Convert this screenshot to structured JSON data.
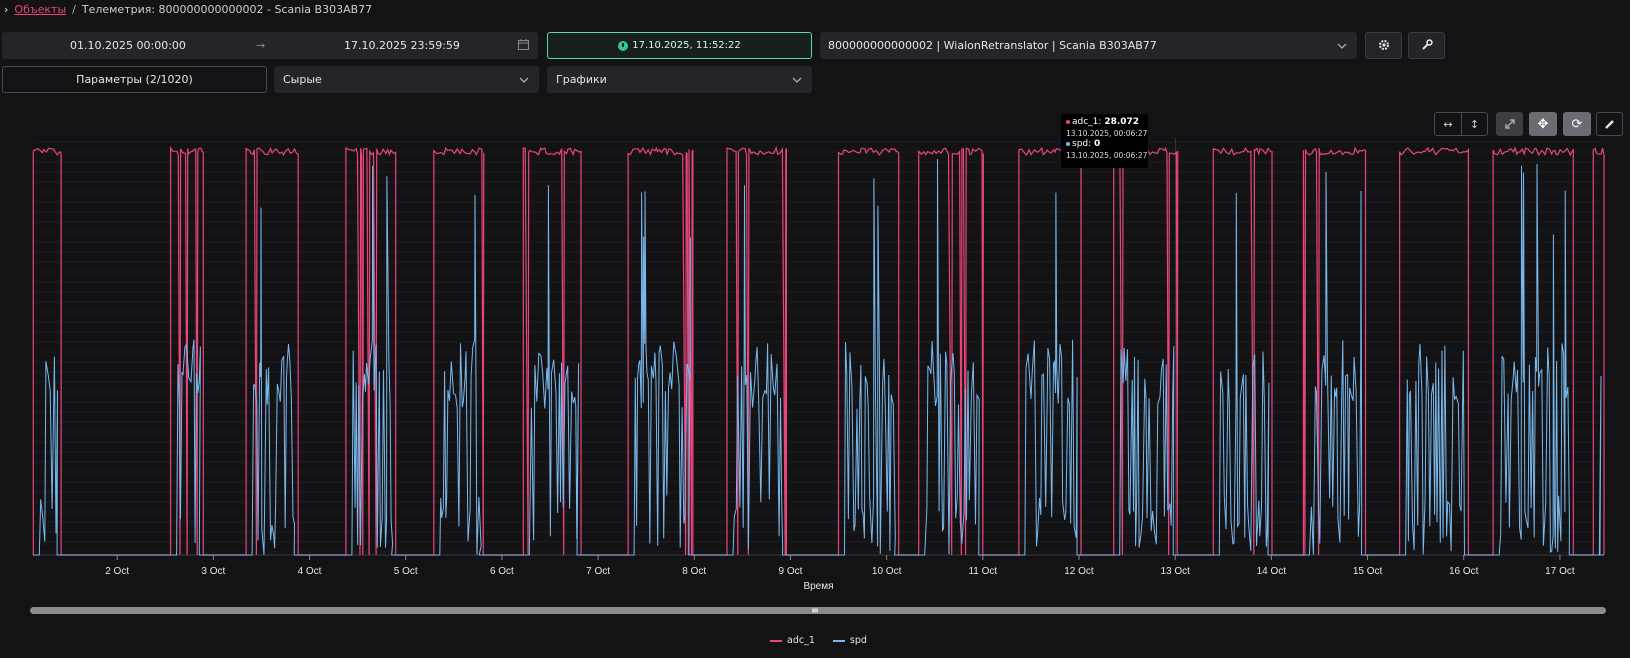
{
  "breadcrumb": {
    "root": "Объекты",
    "separator": "/",
    "current": "Телеметрия: 800000000000002 - Scania В303АВ77"
  },
  "filters": {
    "date_from": "01.10.2025 00:00:00",
    "date_to": "17.10.2025 23:59:59",
    "now": "17.10.2025, 11:52:22",
    "device": "800000000000002 | WialonRetranslator | Scania В303АВ77",
    "params": "Параметры (2/1020)",
    "data_type": "Сырые",
    "view": "Графики"
  },
  "icons": {
    "breadcrumb_chevron": "chevron-right-icon",
    "arrow": "arrow-right-icon",
    "calendar": "calendar-icon",
    "clock": "clock-icon",
    "settings": "gear-icon",
    "tools": "wrench-icon",
    "dropdown": "chevron-down-icon"
  },
  "colors": {
    "accent": "#e8457a",
    "series_adc": "#e8457a",
    "series_spd": "#7ab8ec",
    "now_border": "#5fd6a4",
    "background": "#131316"
  },
  "tooltip": {
    "adc_label": "adc_1:",
    "adc_value": "28.072",
    "adc_time": "13.10.2025, 00:06:27",
    "spd_label": "spd:",
    "spd_value": "0",
    "spd_time": "13.10.2025, 00:06:27"
  },
  "chart_data": {
    "type": "line",
    "xlabel": "Время",
    "ylabel": "",
    "title": "",
    "x_ticks": [
      "2 Oct",
      "3 Oct",
      "4 Oct",
      "5 Oct",
      "6 Oct",
      "7 Oct",
      "8 Oct",
      "9 Oct",
      "10 Oct",
      "11 Oct",
      "12 Oct",
      "13 Oct",
      "14 Oct",
      "15 Oct",
      "16 Oct",
      "17 Oct"
    ],
    "x_range": [
      "2025-10-01T03:00",
      "2025-10-17T11:00"
    ],
    "grid": true,
    "legend_position": "bottom-center",
    "series": [
      {
        "name": "adc_1",
        "color": "#e8457a",
        "active_intervals": [
          [
            "2025-10-01T03:05",
            "2025-10-01T10:00"
          ],
          [
            "2025-10-02T13:20",
            "2025-10-02T21:30"
          ],
          [
            "2025-10-03T08:10",
            "2025-10-03T21:10"
          ],
          [
            "2025-10-04T09:05",
            "2025-10-04T21:30"
          ],
          [
            "2025-10-05T07:00",
            "2025-10-05T19:20"
          ],
          [
            "2025-10-06T05:20",
            "2025-10-06T19:45"
          ],
          [
            "2025-10-07T07:30",
            "2025-10-07T23:40"
          ],
          [
            "2025-10-08T08:10",
            "2025-10-08T23:00"
          ],
          [
            "2025-10-09T12:00",
            "2025-10-10T03:00"
          ],
          [
            "2025-10-10T08:00",
            "2025-10-11T00:00"
          ],
          [
            "2025-10-11T09:00",
            "2025-10-12T00:30"
          ],
          [
            "2025-10-12T08:40",
            "2025-10-13T00:30"
          ],
          [
            "2025-10-13T09:30",
            "2025-10-14T00:10"
          ],
          [
            "2025-10-14T08:00",
            "2025-10-14T23:30"
          ],
          [
            "2025-10-15T08:00",
            "2025-10-16T01:10"
          ],
          [
            "2025-10-16T07:20",
            "2025-10-17T03:20"
          ],
          [
            "2025-10-17T08:20",
            "2025-10-17T11:00"
          ]
        ]
      },
      {
        "name": "spd",
        "color": "#7ab8ec"
      }
    ]
  },
  "legend": {
    "adc_label": "adc_1",
    "spd_label": "spd"
  }
}
